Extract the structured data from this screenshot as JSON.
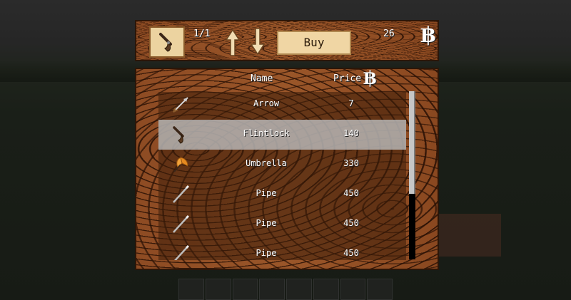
{
  "shop": {
    "counter": "1/1",
    "buy_label": "Buy",
    "balance": "26",
    "currency_symbol": "฿",
    "columns": {
      "name": "Name",
      "price": "Price"
    },
    "items": [
      {
        "name": "Arrow",
        "price": "7",
        "icon": "arrow-icon"
      },
      {
        "name": "Flintlock",
        "price": "140",
        "icon": "flintlock-icon"
      },
      {
        "name": "Umbrella",
        "price": "330",
        "icon": "umbrella-icon"
      },
      {
        "name": "Pipe",
        "price": "450",
        "icon": "pipe-icon"
      },
      {
        "name": "Pipe",
        "price": "450",
        "icon": "pipe-icon"
      },
      {
        "name": "Pipe",
        "price": "450",
        "icon": "pipe-icon"
      }
    ],
    "selected_index": 1,
    "scroll_fraction": 0.61
  },
  "colors": {
    "wood": "#8a4a22",
    "parchment": "#ecd3a0",
    "selected_row": "#b9b9b9"
  }
}
